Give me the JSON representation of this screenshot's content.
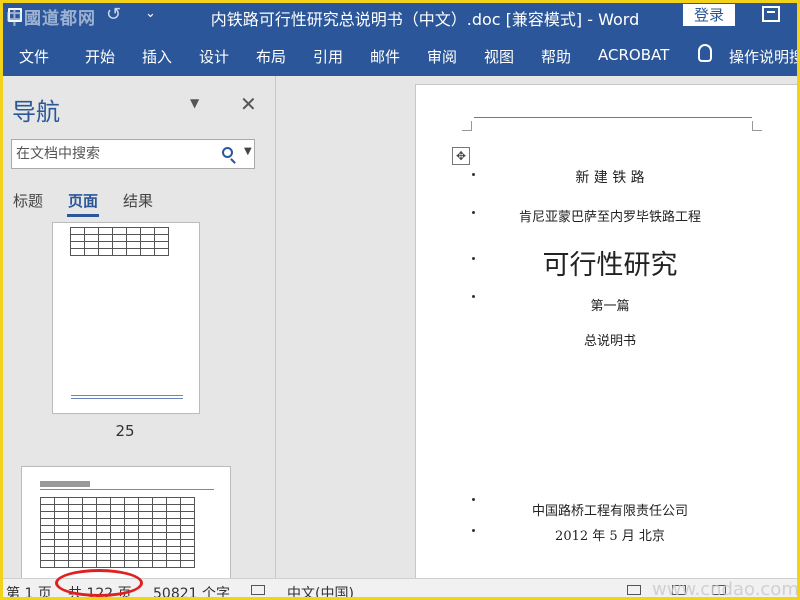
{
  "titlebar": {
    "watermark": "中國道都网",
    "undo_icon": "undo-icon",
    "qa_dropdown": "⌄",
    "title": "内铁路可行性研究总说明书（中文）.doc [兼容模式]  -  Word",
    "login_label": "登录"
  },
  "ribbon": {
    "tabs": [
      "文件",
      "开始",
      "插入",
      "设计",
      "布局",
      "引用",
      "邮件",
      "审阅",
      "视图",
      "帮助",
      "ACROBAT"
    ],
    "tell_me": "操作说明搜"
  },
  "navigation": {
    "title": "导航",
    "search_placeholder": "在文档中搜索",
    "tabs": [
      "标题",
      "页面",
      "结果"
    ],
    "active_tab": "页面",
    "page_number": "25"
  },
  "document": {
    "line1": "新  建  铁  路",
    "line2": "肯尼亚蒙巴萨至内罗毕铁路工程",
    "line3": "可行性研究",
    "line4": "第一篇",
    "line5": "总说明书",
    "company": "中国路桥工程有限责任公司",
    "date": "2012 年 5 月  北京"
  },
  "status": {
    "page": "第 1 页",
    "total": "共 122 页",
    "words": "50821 个字",
    "language": "中文(中国)",
    "watermark": "www.cndao.com"
  },
  "colors": {
    "accent": "#2b579a",
    "highlight": "#e02020",
    "frame": "#f2d21b"
  }
}
